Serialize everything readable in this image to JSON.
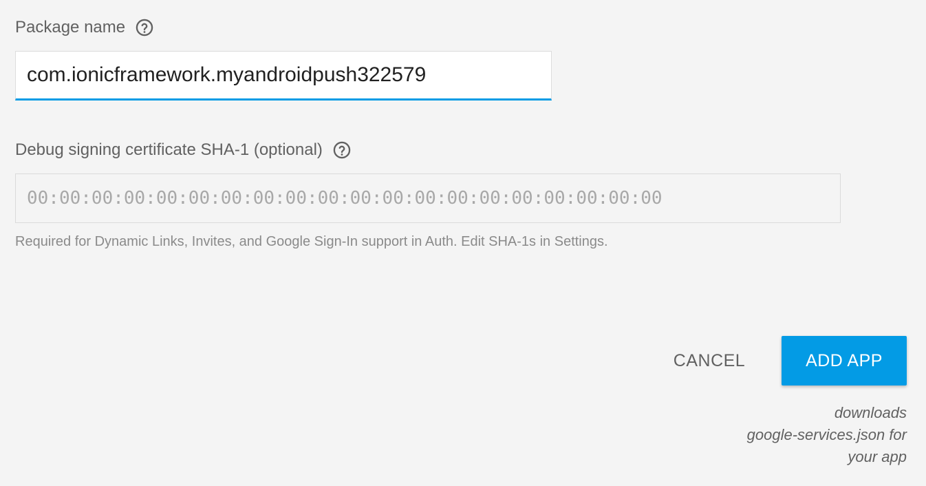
{
  "form": {
    "package": {
      "label": "Package name",
      "help_icon": "help-circle-icon",
      "value": "com.ionicframework.myandroidpush322579"
    },
    "sha1": {
      "label": "Debug signing certificate SHA-1 (optional)",
      "help_icon": "help-circle-icon",
      "value": "",
      "placeholder": "00:00:00:00:00:00:00:00:00:00:00:00:00:00:00:00:00:00:00:00",
      "hint": "Required for Dynamic Links, Invites, and Google Sign-In support in Auth. Edit SHA-1s in Settings."
    }
  },
  "actions": {
    "cancel_label": "CANCEL",
    "add_label": "ADD APP",
    "add_note": [
      "downloads",
      "google-services.json for",
      "your app"
    ]
  },
  "colors": {
    "accent": "#039be5",
    "background": "#f4f4f4",
    "text": "#616161"
  }
}
